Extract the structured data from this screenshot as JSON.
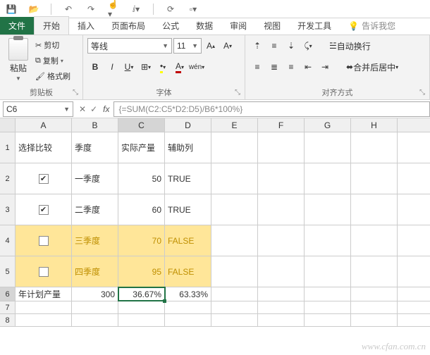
{
  "qat_icons": [
    "save",
    "folder",
    "undo",
    "redo",
    "touch",
    "print",
    "refresh",
    "newdoc"
  ],
  "tabs": {
    "file": "文件",
    "items": [
      "开始",
      "插入",
      "页面布局",
      "公式",
      "数据",
      "审阅",
      "视图",
      "开发工具"
    ],
    "active_index": 0,
    "tell_me": "告诉我您"
  },
  "ribbon": {
    "clipboard": {
      "paste": "粘贴",
      "cut": "剪切",
      "copy": "复制",
      "format_painter": "格式刷",
      "label": "剪贴板"
    },
    "font": {
      "name": "等线",
      "size": "11",
      "label": "字体"
    },
    "alignment": {
      "wrap": "自动换行",
      "merge": "合并后居中",
      "label": "对齐方式"
    }
  },
  "namebox": "C6",
  "formula": "{=SUM(C2:C5*D2:D5)/B6*100%}",
  "columns": [
    "A",
    "B",
    "C",
    "D",
    "E",
    "F",
    "G",
    "H"
  ],
  "active_col": "C",
  "active_row": 6,
  "headers": {
    "A": "选择比较",
    "B": "季度",
    "C": "实际产量",
    "D": "辅助列"
  },
  "rows": [
    {
      "n": 2,
      "checked": true,
      "B": "一季度",
      "C": "50",
      "D": "TRUE",
      "hl": false
    },
    {
      "n": 3,
      "checked": true,
      "B": "二季度",
      "C": "60",
      "D": "TRUE",
      "hl": false
    },
    {
      "n": 4,
      "checked": false,
      "B": "三季度",
      "C": "70",
      "D": "FALSE",
      "hl": true
    },
    {
      "n": 5,
      "checked": false,
      "B": "四季度",
      "C": "95",
      "D": "FALSE",
      "hl": true
    }
  ],
  "summary": {
    "n": 6,
    "A": "年计划产量",
    "B": "300",
    "C": "36.67%",
    "D": "63.33%"
  },
  "empty_rows": [
    7,
    8
  ],
  "watermark": "www.cfan.com.cn"
}
